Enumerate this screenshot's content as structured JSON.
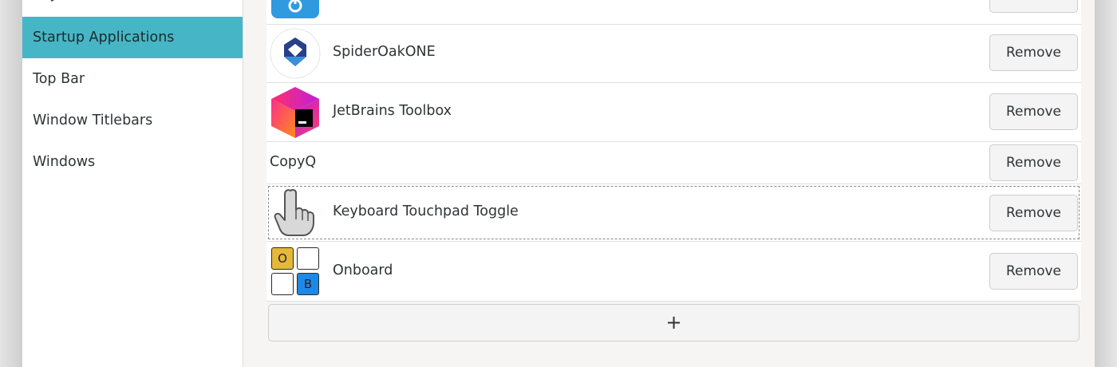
{
  "sidebar": {
    "items": [
      {
        "label": "Keyboard & Mouse"
      },
      {
        "label": "Startup Applications",
        "selected": true
      },
      {
        "label": "Top Bar"
      },
      {
        "label": "Window Titlebars"
      },
      {
        "label": "Windows"
      }
    ],
    "selected_color": "#46b6c6"
  },
  "startup_apps": {
    "rows": [
      {
        "name": "",
        "icon": "app-icon-partial",
        "button": ""
      },
      {
        "name": "SpiderOakONE",
        "icon": "spideroak-icon",
        "button": "Remove"
      },
      {
        "name": "JetBrains Toolbox",
        "icon": "jetbrains-toolbox-icon",
        "button": "Remove"
      },
      {
        "name": "CopyQ",
        "icon": "",
        "button": "Remove"
      },
      {
        "name": "Keyboard Touchpad Toggle",
        "icon": "pointing-hand-icon",
        "button": "Remove"
      },
      {
        "name": "Onboard",
        "icon": "onboard-keyboard-icon",
        "button": "Remove"
      }
    ],
    "add_label": "+",
    "onboard_keys": [
      "O",
      "B"
    ]
  }
}
